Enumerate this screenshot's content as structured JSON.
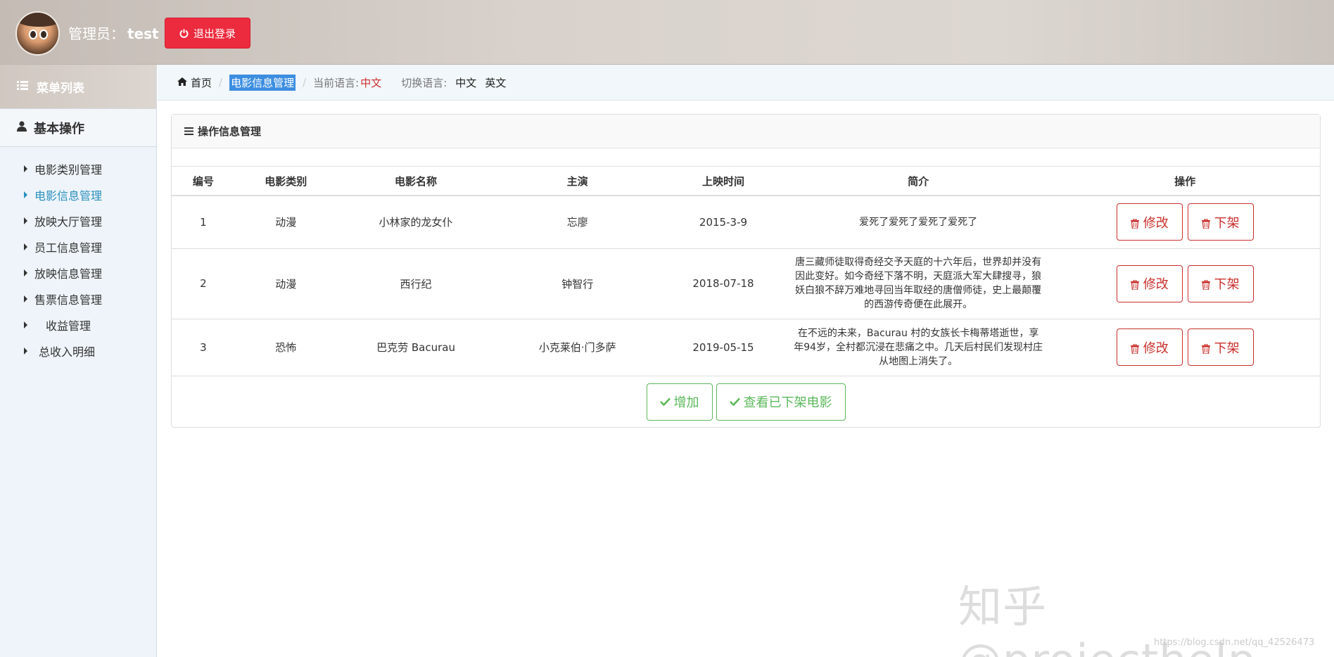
{
  "header": {
    "admin_prefix": "管理员：",
    "admin_name": "test",
    "logout_label": "退出登录"
  },
  "sidebar": {
    "title": "菜单列表",
    "section": "基本操作",
    "items": [
      {
        "label": "电影类别管理"
      },
      {
        "label": "电影信息管理"
      },
      {
        "label": "放映大厅管理"
      },
      {
        "label": "员工信息管理"
      },
      {
        "label": "放映信息管理"
      },
      {
        "label": "售票信息管理"
      },
      {
        "label": "收益管理"
      },
      {
        "label": "总收入明细"
      }
    ]
  },
  "breadcrumb": {
    "home": "首页",
    "current": "电影信息管理",
    "lang_label": "当前语言:",
    "lang_value": "中文",
    "switch_label": "切换语言:",
    "lang_zh": "中文",
    "lang_en": "英文"
  },
  "panel": {
    "title": "操作信息管理",
    "columns": [
      "编号",
      "电影类别",
      "电影名称",
      "主演",
      "上映时间",
      "简介",
      "操作"
    ],
    "rows": [
      {
        "id": "1",
        "category": "动漫",
        "name": "小林家的龙女仆",
        "actor": "忘廖",
        "date": "2015-3-9",
        "desc": "爱死了爱死了爱死了爱死了"
      },
      {
        "id": "2",
        "category": "动漫",
        "name": "西行纪",
        "actor": "钟智行",
        "date": "2018-07-18",
        "desc": "唐三藏师徒取得奇经交予天庭的十六年后，世界却并没有因此变好。如今奇经下落不明，天庭派大军大肆搜寻，狼妖白狼不辞万难地寻回当年取经的唐僧师徒，史上最颠覆的西游传奇便在此展开。"
      },
      {
        "id": "3",
        "category": "恐怖",
        "name": "巴克劳 Bacurau",
        "actor": "小克莱伯·门多萨",
        "date": "2019-05-15",
        "desc": "在不远的未来，Bacurau 村的女族长卡梅蒂塔逝世，享年94岁，全村都沉浸在悲痛之中。几天后村民们发现村庄从地图上消失了。"
      }
    ],
    "edit_label": "修改",
    "remove_label": "下架",
    "add_label": "增加",
    "view_removed_label": "查看已下架电影"
  },
  "watermark": "知乎 @projecthelp",
  "csdn_watermark": "https://blog.csdn.net/qq_42526473",
  "colors": {
    "danger": "#c9302c",
    "success": "#5cb85c",
    "logout": "#ec2b3f",
    "active_menu": "#2a8fbd"
  }
}
